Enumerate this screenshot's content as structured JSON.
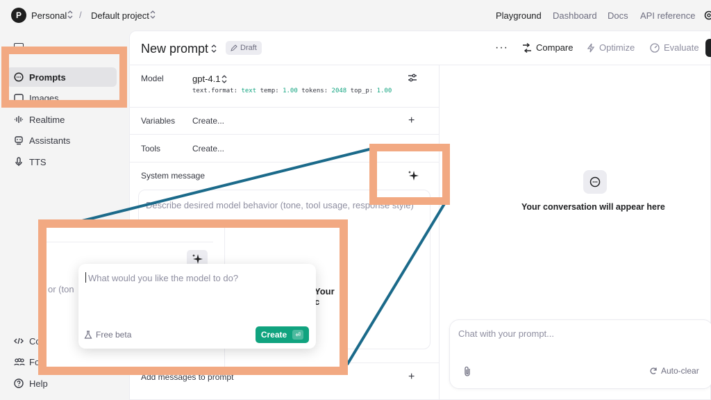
{
  "topbar": {
    "org_initial": "P",
    "org_name": "Personal",
    "separator": "/",
    "project_name": "Default project",
    "nav": {
      "playground": "Playground",
      "dashboard": "Dashboard",
      "docs": "Docs",
      "api_reference": "API reference"
    }
  },
  "sidebar": {
    "items": {
      "prompts": "Prompts",
      "images": "Images",
      "realtime": "Realtime",
      "assistants": "Assistants",
      "tts": "TTS",
      "cookbook": "Co",
      "forum": "Fo",
      "help": "Help"
    },
    "active": "prompts"
  },
  "header": {
    "title": "New prompt",
    "badge": "Draft",
    "more": "···",
    "compare": "Compare",
    "optimize": "Optimize",
    "evaluate": "Evaluate"
  },
  "config": {
    "model_label": "Model",
    "model_value": "gpt-4.1",
    "params": {
      "format_key": "text.format:",
      "format_val": "text",
      "temp_key": "temp:",
      "temp_val": "1.00",
      "tokens_key": "tokens:",
      "tokens_val": "2048",
      "top_p_key": "top_p:",
      "top_p_val": "1.00"
    },
    "variables_label": "Variables",
    "variables_value": "Create...",
    "tools_label": "Tools",
    "tools_value": "Create...",
    "system_label": "System message",
    "system_placeholder": "Describe desired model behavior (tone, tool usage, response style)",
    "add_messages": "Add messages to prompt",
    "plus": "+"
  },
  "conversation": {
    "empty_text": "Your conversation will appear here",
    "chat_placeholder": "Chat with your prompt...",
    "autoclear": "Auto-clear"
  },
  "zoom": {
    "bg_text": "or (ton",
    "bg_your": "Your c",
    "popover_placeholder": "What would you like the model to do?",
    "beta_label": "Free beta",
    "create_label": "Create",
    "create_kbd": "⏎"
  },
  "colors": {
    "highlight": "#f2a982",
    "zoom_line": "#1b6a8a",
    "accent_green": "#10a37f"
  }
}
